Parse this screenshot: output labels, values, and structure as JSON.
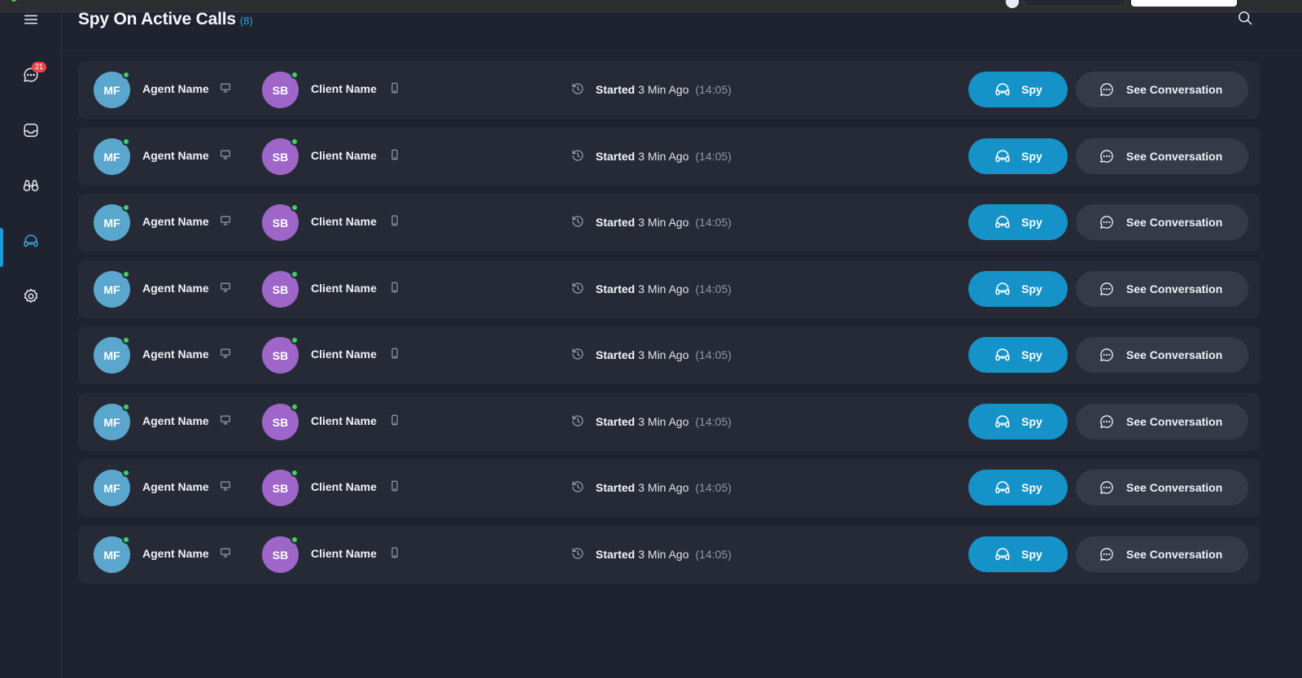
{
  "sidebar": {
    "items": [
      {
        "name": "menu",
        "icon": "hamburger-menu-icon"
      },
      {
        "name": "chats",
        "icon": "chat-bubble-icon",
        "badge": "21"
      },
      {
        "name": "inbox",
        "icon": "inbox-tray-icon"
      },
      {
        "name": "monitor",
        "icon": "binoculars-icon"
      },
      {
        "name": "spy",
        "icon": "headset-icon",
        "active": true
      },
      {
        "name": "settings",
        "icon": "gear-icon"
      }
    ],
    "chat_badge": "21"
  },
  "header": {
    "title": "Spy On Active Calls",
    "count": "(8)"
  },
  "colors": {
    "background": "#1f2330",
    "row": "#262a37",
    "accent": "#1593c9",
    "agent_avatar": "#5aa6cc",
    "client_avatar": "#9d66c8",
    "online": "#39d45c",
    "badge": "#e5484d"
  },
  "calls": [
    {
      "agent_initials": "MF",
      "agent_name": "Agent Name",
      "client_initials": "SB",
      "client_name": "Client Name",
      "started_label": "Started",
      "started_ago": "3 Min Ago",
      "started_time": "(14:05)",
      "spy_label": "Spy",
      "conversation_label": "See Conversation"
    },
    {
      "agent_initials": "MF",
      "agent_name": "Agent Name",
      "client_initials": "SB",
      "client_name": "Client Name",
      "started_label": "Started",
      "started_ago": "3 Min Ago",
      "started_time": "(14:05)",
      "spy_label": "Spy",
      "conversation_label": "See Conversation"
    },
    {
      "agent_initials": "MF",
      "agent_name": "Agent Name",
      "client_initials": "SB",
      "client_name": "Client Name",
      "started_label": "Started",
      "started_ago": "3 Min Ago",
      "started_time": "(14:05)",
      "spy_label": "Spy",
      "conversation_label": "See Conversation"
    },
    {
      "agent_initials": "MF",
      "agent_name": "Agent Name",
      "client_initials": "SB",
      "client_name": "Client Name",
      "started_label": "Started",
      "started_ago": "3 Min Ago",
      "started_time": "(14:05)",
      "spy_label": "Spy",
      "conversation_label": "See Conversation"
    },
    {
      "agent_initials": "MF",
      "agent_name": "Agent Name",
      "client_initials": "SB",
      "client_name": "Client Name",
      "started_label": "Started",
      "started_ago": "3 Min Ago",
      "started_time": "(14:05)",
      "spy_label": "Spy",
      "conversation_label": "See Conversation"
    },
    {
      "agent_initials": "MF",
      "agent_name": "Agent Name",
      "client_initials": "SB",
      "client_name": "Client Name",
      "started_label": "Started",
      "started_ago": "3 Min Ago",
      "started_time": "(14:05)",
      "spy_label": "Spy",
      "conversation_label": "See Conversation"
    },
    {
      "agent_initials": "MF",
      "agent_name": "Agent Name",
      "client_initials": "SB",
      "client_name": "Client Name",
      "started_label": "Started",
      "started_ago": "3 Min Ago",
      "started_time": "(14:05)",
      "spy_label": "Spy",
      "conversation_label": "See Conversation"
    },
    {
      "agent_initials": "MF",
      "agent_name": "Agent Name",
      "client_initials": "SB",
      "client_name": "Client Name",
      "started_label": "Started",
      "started_ago": "3 Min Ago",
      "started_time": "(14:05)",
      "spy_label": "Spy",
      "conversation_label": "See Conversation"
    }
  ]
}
